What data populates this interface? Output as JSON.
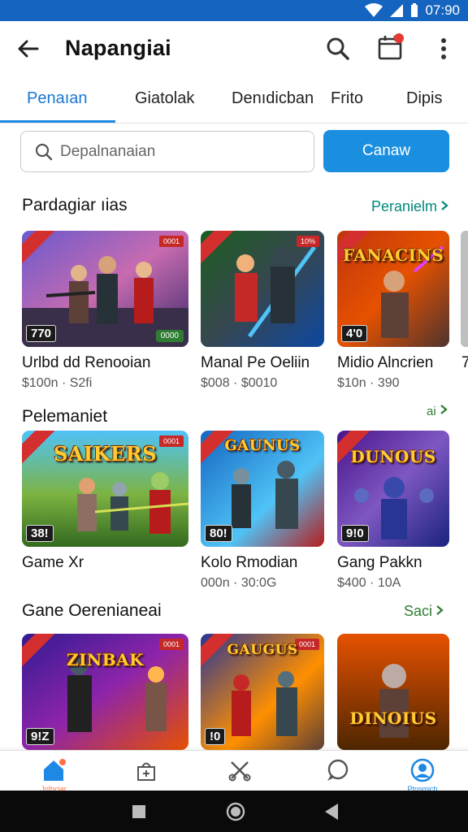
{
  "status_bar": {
    "time": "07:90"
  },
  "app_bar": {
    "title": "Napangiai",
    "icons": [
      "back-arrow-icon",
      "search-icon",
      "calendar-notification-icon",
      "more-vert-icon"
    ]
  },
  "tabs": [
    "Penaıan",
    "Giatolak",
    "Denıdicban",
    "Frito",
    "Dipis"
  ],
  "search": {
    "placeholder": "Depalnanaian",
    "button_label": "Canaw"
  },
  "sections": [
    {
      "title": "Pardagiar ıias",
      "link_label": "Peranielm",
      "cards": [
        {
          "name": "Urlbd dd Renooian",
          "price": "$100n · S2fi",
          "badge": "770",
          "tag": "0001",
          "badge_right": "0000"
        },
        {
          "name": "Manal Pe Oeliin",
          "price": "$008 · $0010",
          "tag": "10%"
        },
        {
          "name": "Midio Alncrien",
          "price": "$10n · 390",
          "badge": "4'0",
          "logo": "FANACINS"
        }
      ],
      "peek_text": "7"
    },
    {
      "title": "Pelemaniet",
      "link_label": "ai",
      "cards": [
        {
          "name": "Game Xr",
          "price": "",
          "badge": "38!",
          "tag": "0001",
          "logo": "SAIKERS"
        },
        {
          "name": "Kolo Rmodian",
          "price": "000n · 30:0G",
          "badge": "80!",
          "logo": "GAUNUS"
        },
        {
          "name": "Gang Pakkn",
          "price": "$400 · 10A",
          "badge": "9!0",
          "logo": "DUNOUS"
        }
      ]
    },
    {
      "title": "Gane Oerenianeai",
      "link_label": "Saci",
      "cards": [
        {
          "badge": "9!Z",
          "logo": "ZINBAK",
          "tag": "0001"
        },
        {
          "badge": "!0",
          "logo": "GAUGUS",
          "tag": "0001"
        },
        {
          "logo": "DINOIUS"
        }
      ]
    }
  ],
  "bottom_nav": [
    {
      "icon": "home-icon",
      "label": "Jnfnciar",
      "active": true
    },
    {
      "icon": "store-icon",
      "label": ""
    },
    {
      "icon": "tools-icon",
      "label": ""
    },
    {
      "icon": "chat-icon",
      "label": ""
    },
    {
      "icon": "profile-icon",
      "label": "Ptnsmich",
      "active": true
    }
  ],
  "colors": {
    "accent": "#1e88e5",
    "status_bar": "#1565c0",
    "link_teal": "#00897b",
    "link_green": "#2e7d32"
  }
}
